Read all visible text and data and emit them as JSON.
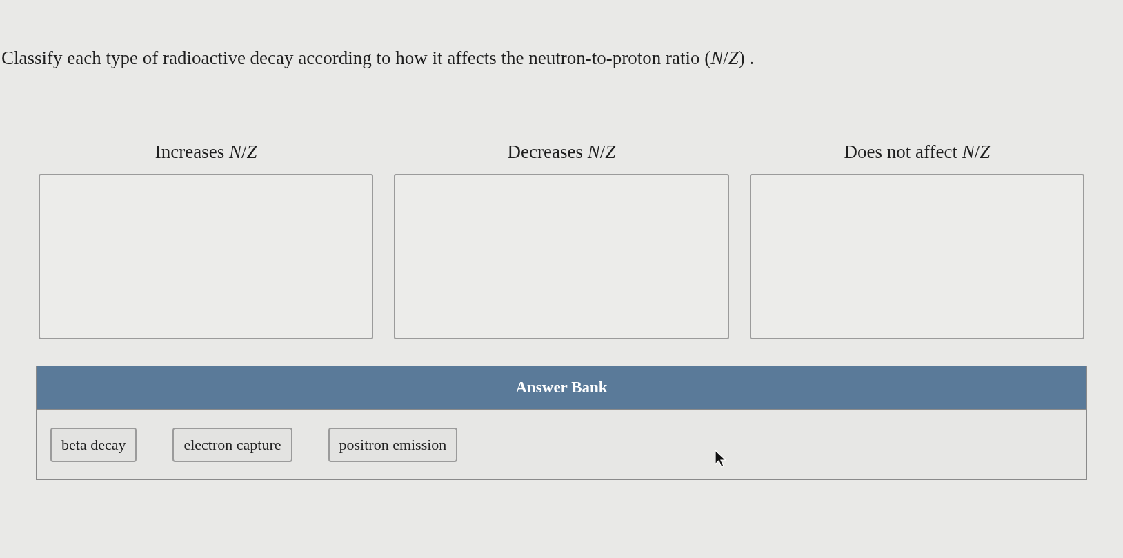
{
  "question": {
    "text": "Classify each type of radioactive decay according to how it affects the neutron-to-proton ratio (*N*/*Z*) ."
  },
  "bins": [
    {
      "label": "Increases *N*/*Z*"
    },
    {
      "label": "Decreases *N*/*Z*"
    },
    {
      "label": "Does not affect *N*/*Z*"
    }
  ],
  "answer_bank": {
    "title": "Answer Bank",
    "items": [
      "beta decay",
      "electron capture",
      "positron emission"
    ]
  }
}
